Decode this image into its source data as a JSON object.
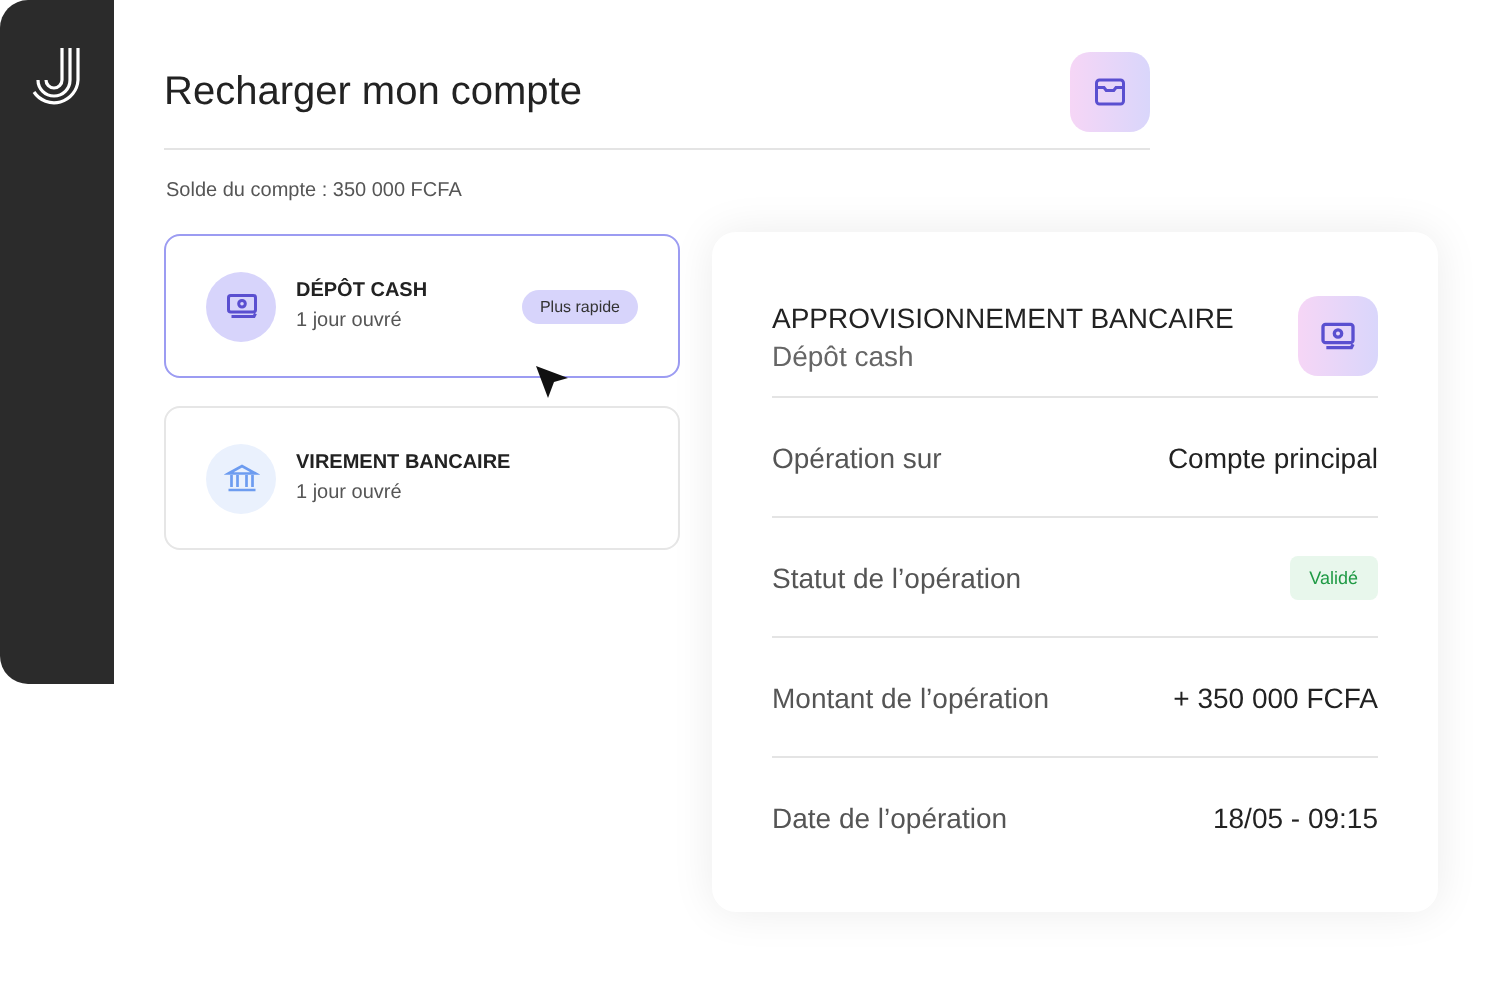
{
  "page": {
    "title": "Recharger mon compte",
    "balance": "Solde du compte : 350 000 FCFA"
  },
  "options": [
    {
      "kind": "cash",
      "title": "DÉPÔT CASH",
      "subtitle": "1 jour ouvré",
      "badge": "Plus rapide",
      "selected": true
    },
    {
      "kind": "bank",
      "title": "VIREMENT BANCAIRE",
      "subtitle": "1 jour ouvré",
      "selected": false
    }
  ],
  "details": {
    "title": "APPROVISIONNEMENT BANCAIRE",
    "subtitle": "Dépôt cash",
    "rows": [
      {
        "kind": "text",
        "label": "Opération sur",
        "value": "Compte principal"
      },
      {
        "kind": "status",
        "label": "Statut de l’opération",
        "value": "Validé"
      },
      {
        "kind": "text",
        "label": "Montant de l’opération",
        "value": "+ 350 000 FCFA"
      },
      {
        "kind": "text",
        "label": "Date de l’opération",
        "value": "18/05 - 09:15"
      }
    ]
  }
}
